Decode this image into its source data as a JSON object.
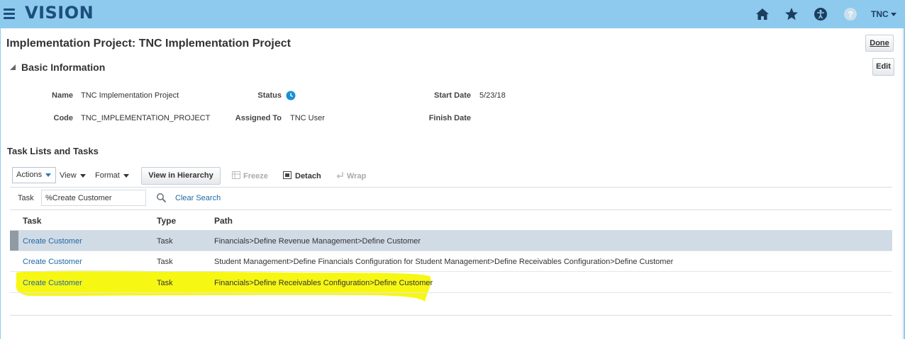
{
  "header": {
    "logo": "VISION",
    "user": "TNC",
    "icons": [
      "home-icon",
      "star-icon",
      "accessibility-icon",
      "help-icon"
    ]
  },
  "page": {
    "title": "Implementation Project: TNC Implementation Project",
    "done_label": "Done",
    "edit_label": "Edit"
  },
  "basic_info": {
    "heading": "Basic Information",
    "name_label": "Name",
    "name_value": "TNC Implementation Project",
    "code_label": "Code",
    "code_value": "TNC_IMPLEMENTATION_PROJECT",
    "status_label": "Status",
    "assigned_label": "Assigned To",
    "assigned_value": "TNC User",
    "start_label": "Start Date",
    "start_value": "5/23/18",
    "finish_label": "Finish Date",
    "finish_value": ""
  },
  "tasks": {
    "heading": "Task Lists and Tasks",
    "toolbar": {
      "actions": "Actions",
      "view": "View",
      "format": "Format",
      "view_hierarchy": "View in Hierarchy",
      "freeze": "Freeze",
      "detach": "Detach",
      "wrap": "Wrap"
    },
    "filter": {
      "label": "Task",
      "value": "%Create Customer",
      "clear": "Clear Search"
    },
    "columns": [
      "Task",
      "Type",
      "Path"
    ],
    "rows": [
      {
        "task": "Create Customer",
        "type": "Task",
        "path": "Financials>Define Revenue Management>Define Customer",
        "selected": true
      },
      {
        "task": "Create Customer",
        "type": "Task",
        "path": "Student Management>Define Financials Configuration for Student Management>Define Receivables Configuration>Define Customer",
        "selected": false
      },
      {
        "task": "Create Customer",
        "type": "Task",
        "path": "Financials>Define Receivables Configuration>Define Customer",
        "selected": false,
        "highlighted": true
      }
    ]
  },
  "colors": {
    "header_bg": "#8ec9ee",
    "link": "#1f68a6",
    "highlight": "#f7f714",
    "selected_row": "#d1dbe6"
  }
}
